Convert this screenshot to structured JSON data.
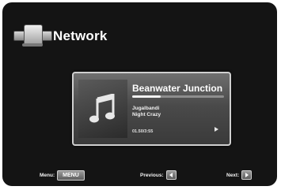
{
  "header": {
    "title": "Network",
    "icon": "network-icon"
  },
  "now_playing": {
    "title": "Beanwater Junction",
    "artist": "Jugalbandi",
    "album": "Night Crazy",
    "time": "01.50/3:55",
    "progress": 0.31
  },
  "footer": {
    "menu_label": "Menu:",
    "menu_button": "MENU",
    "previous_label": "Previous:",
    "next_label": "Next:"
  }
}
